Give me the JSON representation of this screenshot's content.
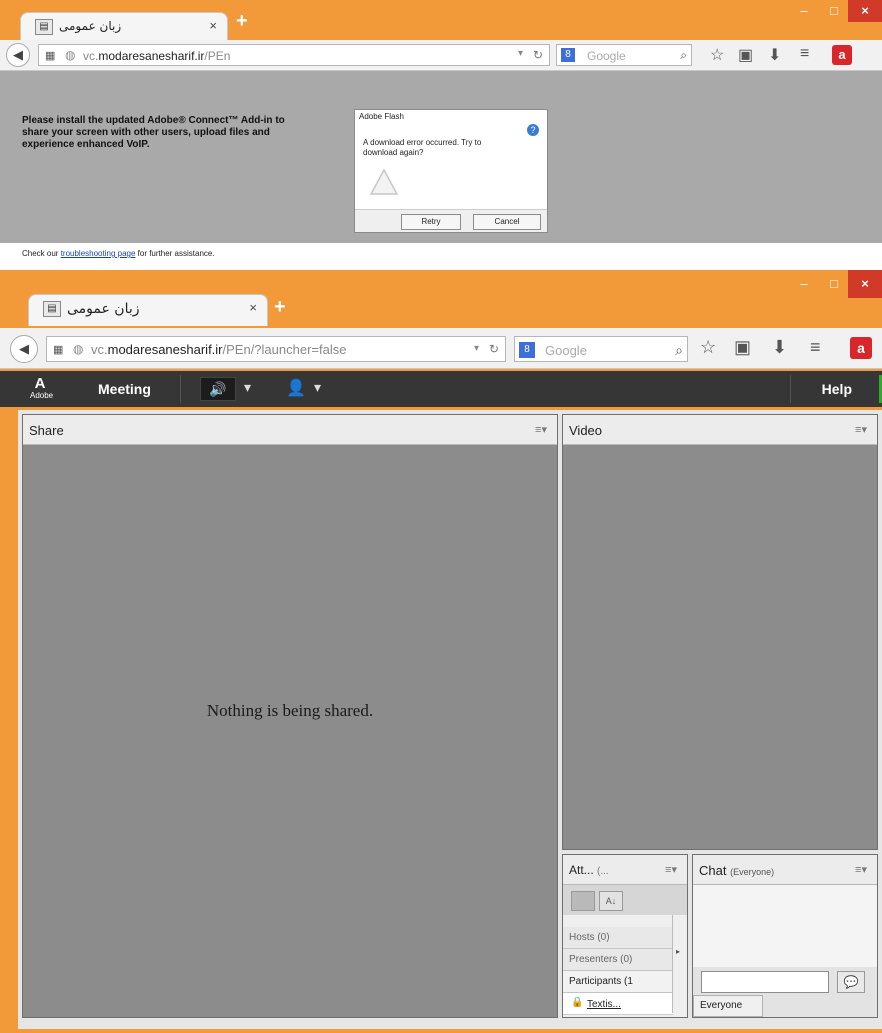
{
  "browser": {
    "tab_title": "زبان عمومی",
    "tab_favicon": "page-icon",
    "close_glyph": "×",
    "new_tab_glyph": "+",
    "search_placeholder": "Google",
    "search_engine_glyph": "8",
    "window_controls": {
      "minimize": "–",
      "maximize": "□",
      "close": "×"
    },
    "toolbar_icons": [
      "bookmark-star-icon",
      "clipboard-icon",
      "download-icon",
      "menu-icon",
      "avira-icon"
    ],
    "accent_color": "#f29a3a"
  },
  "window1": {
    "url_domain": "modaresanesharif.ir",
    "url_prefix": "vc.",
    "url_path": "/PEn",
    "install_message": "Please install the updated Adobe® Connect™ Add-in to share your screen with other users, upload files and experience enhanced VoIP.",
    "dialog": {
      "title": "Adobe Flash",
      "message": "A download error occurred. Try to download again?",
      "retry_label": "Retry",
      "cancel_label": "Cancel"
    },
    "assistance": {
      "before": "Check our ",
      "link": "troubleshooting page",
      "after": " for further assistance."
    }
  },
  "window2": {
    "url_prefix": "vc.",
    "url_domain": "modaresanesharif.ir",
    "url_path": "/PEn/?launcher=false",
    "app_bar": {
      "logo_text": "Adobe",
      "meeting_label": "Meeting",
      "help_label": "Help",
      "speaker_on_color": "#4fd13c"
    },
    "share_pod": {
      "title": "Share",
      "empty_message": "Nothing is being shared."
    },
    "video_pod": {
      "title": "Video"
    },
    "attendees_pod": {
      "title": "Att...",
      "title_extra": "(...",
      "sections": [
        "Hosts (0)",
        "Presenters (0)",
        "Participants (1"
      ],
      "user": "Textis..."
    },
    "chat_pod": {
      "title": "Chat",
      "subtitle": "(Everyone)",
      "target": "Everyone"
    }
  }
}
